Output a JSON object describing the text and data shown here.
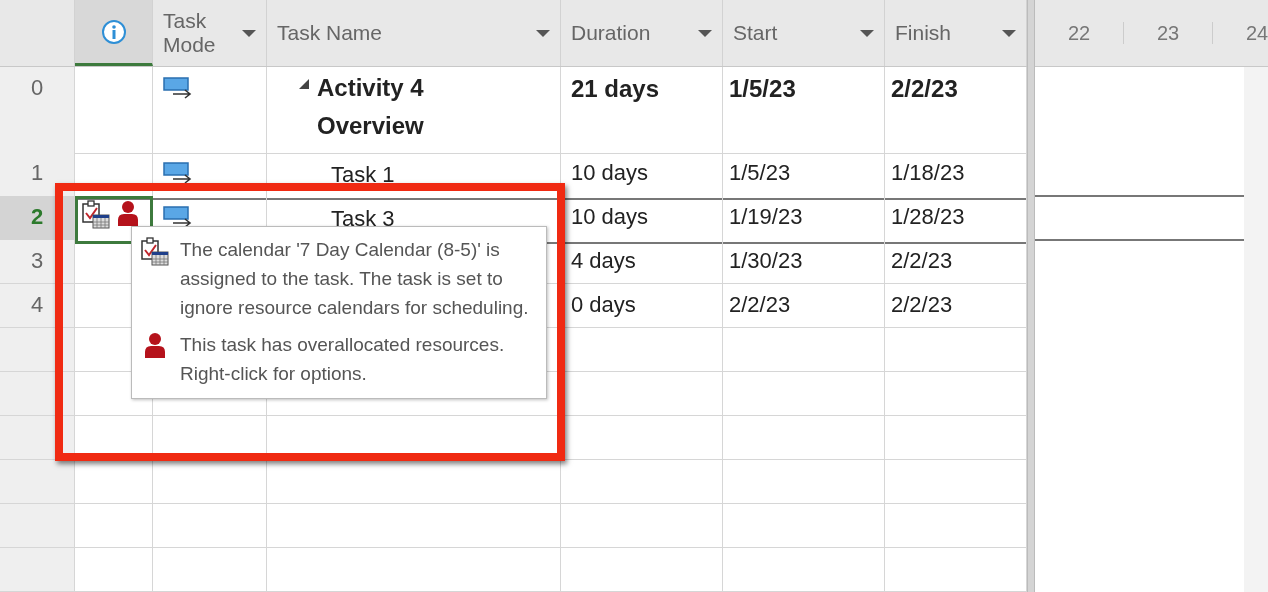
{
  "columns": [
    {
      "kind": "info"
    },
    {
      "kind": "text",
      "label": "Task Mode",
      "dropdown": true
    },
    {
      "kind": "text",
      "label": "Task Name",
      "dropdown": true
    },
    {
      "kind": "text",
      "label": "Duration",
      "dropdown": true
    },
    {
      "kind": "text",
      "label": "Start",
      "dropdown": true
    },
    {
      "kind": "text",
      "label": "Finish",
      "dropdown": true
    }
  ],
  "timescale": [
    "22",
    "23",
    "24"
  ],
  "rows": [
    {
      "id": "0",
      "selected": false,
      "kind": "summary",
      "expanded": true,
      "name": "Activity 4 Overview",
      "duration": "21 days",
      "start": "1/5/23",
      "finish": "2/2/23"
    },
    {
      "id": "1",
      "selected": false,
      "kind": "task",
      "name": "Task 1",
      "duration": "10 days",
      "start": "1/5/23",
      "finish": "1/18/23"
    },
    {
      "id": "2",
      "selected": true,
      "kind": "task",
      "name": "Task 3",
      "duration": "10 days",
      "start": "1/19/23",
      "finish": "1/28/23",
      "indicators": [
        {
          "kind": "calendar"
        },
        {
          "kind": "overallocated"
        }
      ]
    },
    {
      "id": "3",
      "selected": false,
      "kind": "task",
      "duration": "4 days",
      "start": "1/30/23",
      "finish": "2/2/23"
    },
    {
      "id": "4",
      "selected": false,
      "kind": "task",
      "duration": "0 days",
      "start": "2/2/23",
      "finish": "2/2/23"
    }
  ],
  "tooltip": {
    "items": [
      {
        "kind": "calendar",
        "text": "The calendar '7 Day Calendar (8-5)' is assigned to the task. The task is set to ignore resource calendars for scheduling."
      },
      {
        "kind": "overallocated",
        "text": "This task has overallocated resources. Right-click for options."
      }
    ]
  }
}
